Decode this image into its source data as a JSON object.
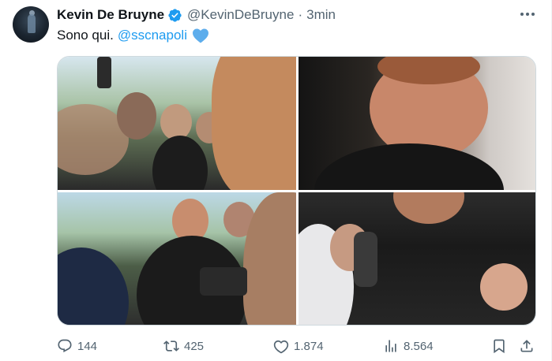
{
  "tweet": {
    "display_name": "Kevin De Bruyne",
    "handle": "@KevinDeBruyne",
    "separator": "·",
    "time": "3min",
    "text": "Sono qui.",
    "mention": "@sscnapoli",
    "emoji": "blue-heart",
    "verified_color": "#1d9bf0"
  },
  "media": {
    "photos": [
      {
        "label": "photo-1"
      },
      {
        "label": "photo-2"
      },
      {
        "label": "photo-3"
      },
      {
        "label": "photo-4"
      }
    ]
  },
  "actions": {
    "replies": "144",
    "reposts": "425",
    "likes": "1.874",
    "views": "8.564"
  },
  "colors": {
    "text": "#0f1419",
    "secondary": "#536471",
    "accent": "#1d9bf0"
  }
}
